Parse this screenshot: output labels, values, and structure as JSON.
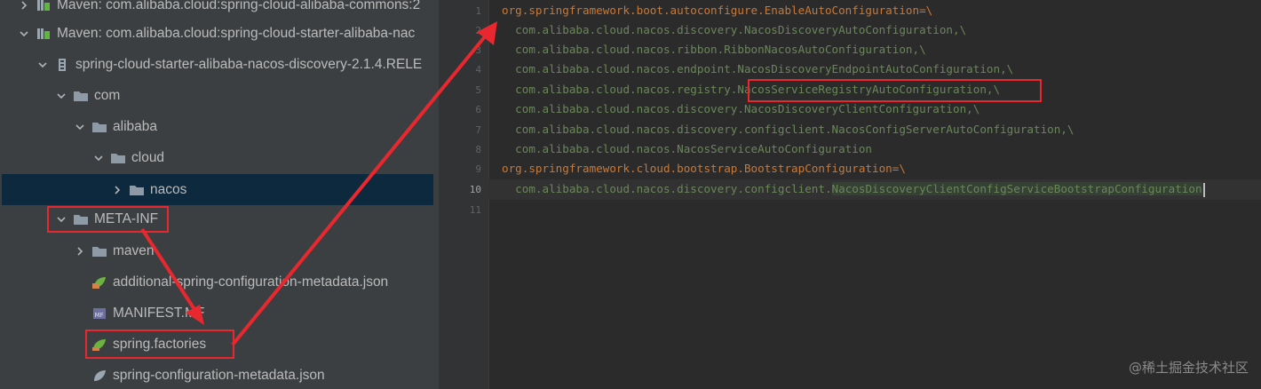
{
  "tree": {
    "rows": [
      {
        "label": "Maven: com.alibaba.cloud:spring-cloud-alibaba-commons:2",
        "icon": "library-icon",
        "expanded": false
      },
      {
        "label": "Maven: com.alibaba.cloud:spring-cloud-starter-alibaba-nac",
        "icon": "library-icon",
        "expanded": true
      },
      {
        "label": "spring-cloud-starter-alibaba-nacos-discovery-2.1.4.RELE",
        "icon": "jar-icon",
        "expanded": true
      },
      {
        "label": "com",
        "icon": "folder-icon",
        "expanded": true
      },
      {
        "label": "alibaba",
        "icon": "folder-icon",
        "expanded": true
      },
      {
        "label": "cloud",
        "icon": "folder-icon",
        "expanded": true
      },
      {
        "label": "nacos",
        "icon": "folder-icon",
        "expanded": false
      },
      {
        "label": "META-INF",
        "icon": "folder-icon",
        "expanded": true
      },
      {
        "label": "maven",
        "icon": "folder-icon",
        "expanded": false
      },
      {
        "label": "additional-spring-configuration-metadata.json",
        "icon": "spring-json-icon"
      },
      {
        "label": "MANIFEST.MF",
        "icon": "manifest-icon"
      },
      {
        "label": "spring.factories",
        "icon": "spring-factories-icon"
      },
      {
        "label": "spring-configuration-metadata.json",
        "icon": "spring-json-icon"
      }
    ]
  },
  "editor": {
    "line_numbers": [
      "1",
      "2",
      "3",
      "4",
      "5",
      "6",
      "7",
      "8",
      "9",
      "10",
      "11"
    ],
    "lines": [
      {
        "key": "org.springframework.boot.autoconfigure.EnableAutoConfiguration=\\"
      },
      {
        "val": "  com.alibaba.cloud.nacos.discovery.NacosDiscoveryAutoConfiguration,\\"
      },
      {
        "val": "  com.alibaba.cloud.nacos.ribbon.RibbonNacosAutoConfiguration,\\"
      },
      {
        "val": "  com.alibaba.cloud.nacos.endpoint.NacosDiscoveryEndpointAutoConfiguration,\\"
      },
      {
        "val_pre": "  com.alibaba.cloud.nacos.registry.",
        "val_box": "NacosServiceRegistryAutoConfiguration,\\"
      },
      {
        "val": "  com.alibaba.cloud.nacos.discovery.NacosDiscoveryClientConfiguration,\\"
      },
      {
        "val": "  com.alibaba.cloud.nacos.discovery.configclient.NacosConfigServerAutoConfiguration,\\"
      },
      {
        "val": "  com.alibaba.cloud.nacos.NacosServiceAutoConfiguration"
      },
      {
        "key": "org.springframework.cloud.bootstrap.BootstrapConfiguration=\\"
      },
      {
        "val_pre": "  com.alibaba.cloud.nacos.discovery.configclient.",
        "val_hl": "NacosDiscoveryClientConfigServiceBootstrapConfiguration"
      },
      {
        "val": ""
      }
    ]
  },
  "watermark": "@稀土掘金技术社区",
  "colors": {
    "annotation": "#e8282e",
    "key": "#cc7832",
    "value": "#6a8759"
  }
}
